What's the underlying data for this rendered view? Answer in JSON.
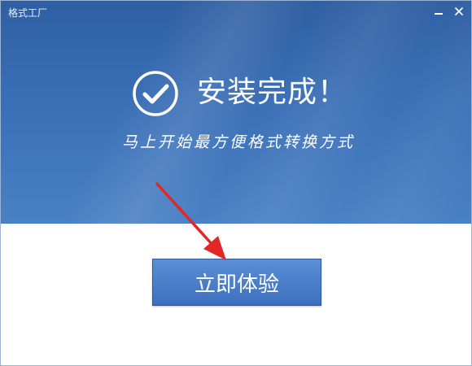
{
  "window": {
    "title": "格式工厂",
    "minimize_icon": "minimize-icon",
    "close_icon": "close-icon"
  },
  "banner": {
    "check_icon": "check-circle-icon",
    "headline": "安装完成！",
    "subline": "马上开始最方便格式转换方式"
  },
  "action": {
    "button_label": "立即体验",
    "arrow_icon": "red-pointer-arrow-icon"
  },
  "colors": {
    "banner": "#3a6fb6",
    "button": "#4a7fcb",
    "arrow": "#e32626"
  }
}
